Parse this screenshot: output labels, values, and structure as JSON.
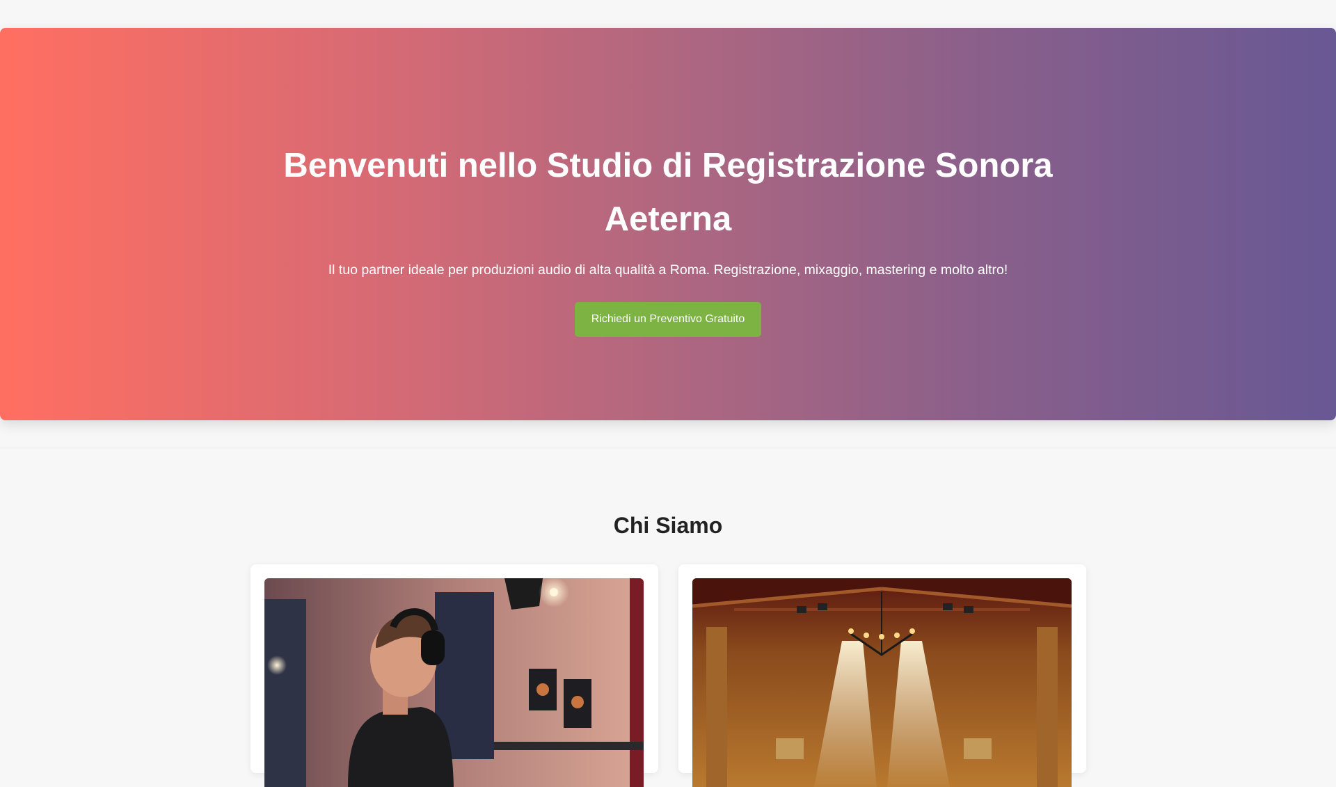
{
  "hero": {
    "title": "Benvenuti nello Studio di Registrazione Sonora Aeterna",
    "subtitle": "Il tuo partner ideale per produzioni audio di alta qualità a Roma. Registrazione, mixaggio, mastering e molto altro!",
    "cta_label": "Richiedi un Preventivo Gratuito"
  },
  "about": {
    "title": "Chi Siamo"
  },
  "colors": {
    "gradient_start": "#ff6f61",
    "gradient_end": "#685894",
    "cta_green": "#7cb342",
    "background": "#f7f7f7"
  }
}
